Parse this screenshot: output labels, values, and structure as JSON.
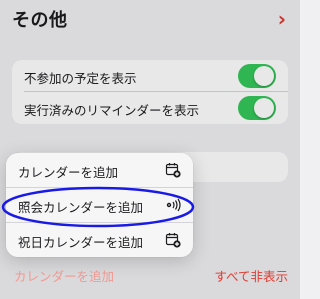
{
  "section": {
    "title": "その他",
    "chevron": "›"
  },
  "toggles": [
    {
      "label": "不参加の予定を表示",
      "on": true
    },
    {
      "label": "実行済みのリマインダーを表示",
      "on": true
    }
  ],
  "menu": {
    "items": [
      {
        "label": "カレンダーを追加",
        "icon": "calendar-add-icon"
      },
      {
        "label": "照会カレンダーを追加",
        "icon": "subscribe-broadcast-icon"
      },
      {
        "label": "祝日カレンダーを追加",
        "icon": "calendar-add-icon"
      }
    ]
  },
  "footer": {
    "add_calendar": "カレンダーを追加",
    "hide_all": "すべて非表示"
  },
  "colors": {
    "accent_red": "#e03a30",
    "toggle_green": "#34c759",
    "highlight_blue": "#1a1ae6"
  }
}
